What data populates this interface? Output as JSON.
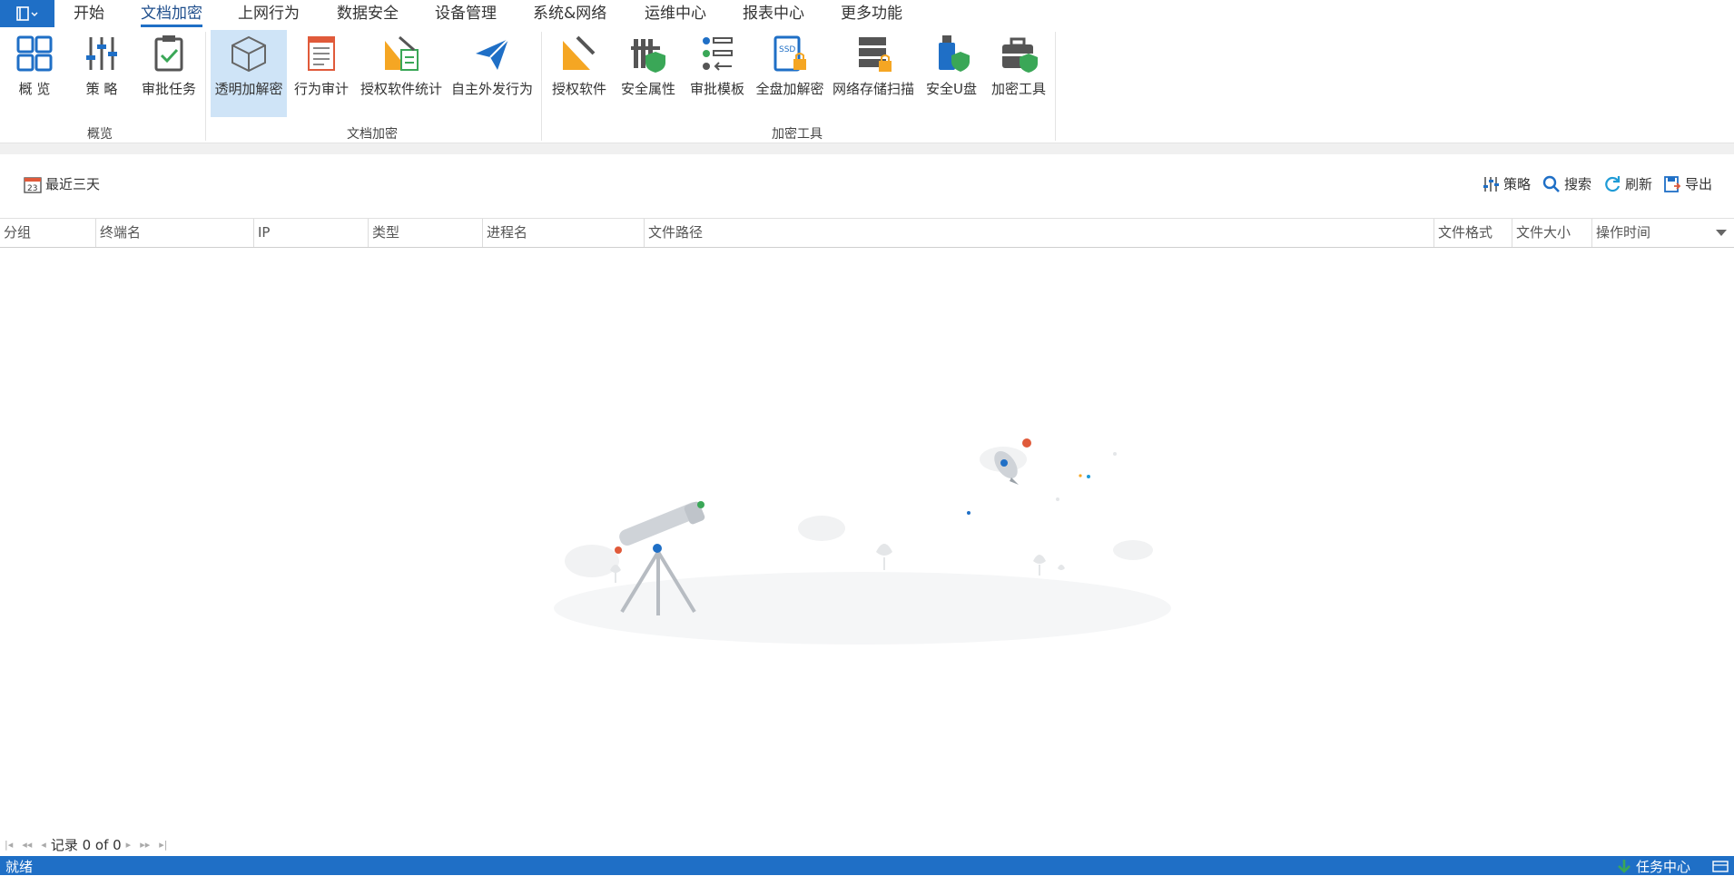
{
  "menu": {
    "tabs": [
      "开始",
      "文档加密",
      "上网行为",
      "数据安全",
      "设备管理",
      "系统&网络",
      "运维中心",
      "报表中心",
      "更多功能"
    ],
    "active": "文档加密"
  },
  "ribbon": {
    "groups": [
      {
        "label": "概览",
        "buttons": [
          "概 览",
          "策 略",
          "审批任务"
        ]
      },
      {
        "label": "文档加密",
        "buttons": [
          "透明加解密",
          "行为审计",
          "授权软件统计",
          "自主外发行为"
        ]
      },
      {
        "label": "加密工具",
        "buttons": [
          "授权软件",
          "安全属性",
          "审批模板",
          "全盘加解密",
          "网络存储扫描",
          "安全U盘",
          "加密工具"
        ]
      }
    ],
    "selected": "透明加解密"
  },
  "toolbar": {
    "date_range": "最近三天",
    "calendar_day": "23",
    "strategy": "策略",
    "search": "搜索",
    "refresh": "刷新",
    "export": "导出"
  },
  "table": {
    "columns": [
      "分组",
      "终端名",
      "IP",
      "类型",
      "进程名",
      "文件路径",
      "文件格式",
      "文件大小",
      "操作时间"
    ]
  },
  "pager": {
    "records": "记录 0 of 0"
  },
  "status": {
    "left": "就绪",
    "task_center": "任务中心"
  },
  "colors": {
    "accent": "#1f6fc6",
    "selected_bg": "#cfe4f7",
    "orange": "#f5a623",
    "green": "#3aa757"
  }
}
